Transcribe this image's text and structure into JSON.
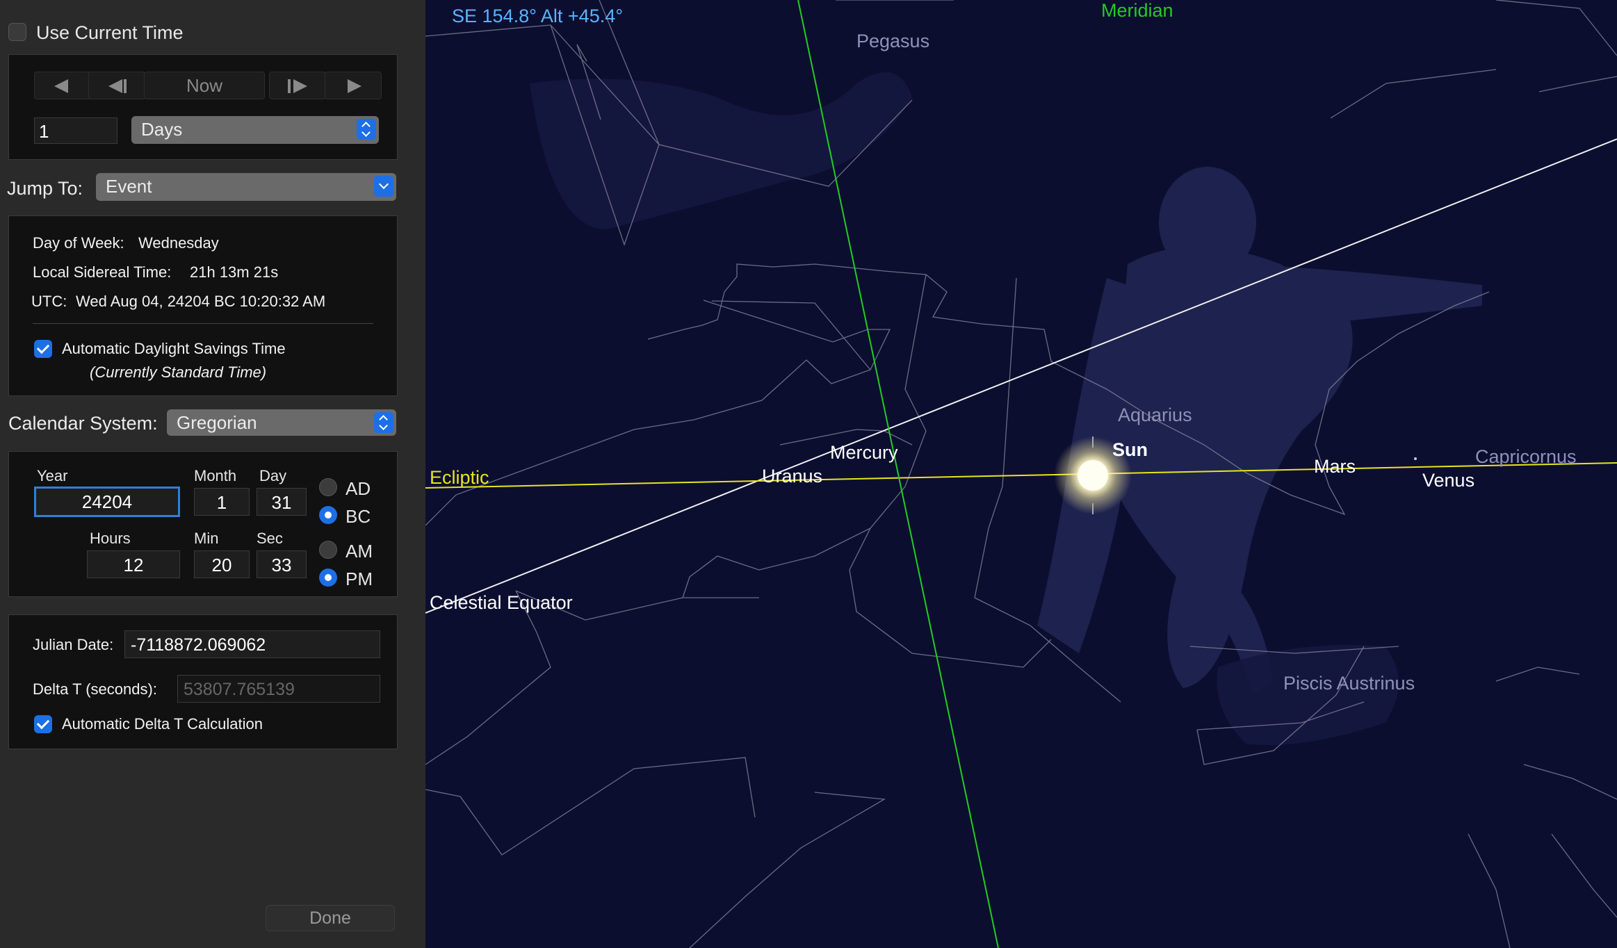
{
  "panel": {
    "use_current_time": {
      "label": "Use Current Time",
      "checked": false
    },
    "nav": {
      "now_label": "Now"
    },
    "step": {
      "value": "1",
      "unit": "Days"
    },
    "jump_to": {
      "label": "Jump To:",
      "value": "Event"
    },
    "info": {
      "dow_label": "Day of Week:",
      "dow_value": "Wednesday",
      "lst_label": "Local Sidereal Time:",
      "lst_value": "21h 13m 21s",
      "utc_label": "UTC:",
      "utc_value": "Wed Aug 04, 24204 BC 10:20:32 AM",
      "dst_label": "Automatic Daylight Savings Time",
      "dst_checked": true,
      "dst_note": "(Currently Standard Time)"
    },
    "calendar": {
      "label": "Calendar System:",
      "value": "Gregorian"
    },
    "date": {
      "year_label": "Year",
      "year": "24204",
      "month_label": "Month",
      "month": "1",
      "day_label": "Day",
      "day": "31",
      "hours_label": "Hours",
      "hours": "12",
      "min_label": "Min",
      "min": "20",
      "sec_label": "Sec",
      "sec": "33",
      "era_ad": "AD",
      "era_bc": "BC",
      "era_selected": "BC",
      "ampm_am": "AM",
      "ampm_pm": "PM",
      "ampm_selected": "PM"
    },
    "julian": {
      "jd_label": "Julian Date:",
      "jd_value": "-7118872.069062",
      "dt_label": "Delta T (seconds):",
      "dt_value": "53807.765139",
      "auto_dt_label": "Automatic Delta T Calculation",
      "auto_dt_checked": true
    },
    "done_label": "Done"
  },
  "sky": {
    "readout": "SE 154.8° Alt +45.4°",
    "lines": {
      "meridian": "Meridian",
      "ecliptic": "Ecliptic",
      "equator": "Celestial Equator"
    },
    "constellations": {
      "pegasus": "Pegasus",
      "aquarius": "Aquarius",
      "capricornus": "Capricornus",
      "piscis_austrinus": "Piscis Austrinus"
    },
    "bodies": {
      "sun": "Sun",
      "mercury": "Mercury",
      "uranus": "Uranus",
      "mars": "Mars",
      "venus": "Venus"
    },
    "colors": {
      "meridian": "#22cc22",
      "ecliptic": "#e6e619",
      "equator": "#ffffff",
      "readout": "#5ab4ff",
      "background": "#0c0e30"
    }
  }
}
